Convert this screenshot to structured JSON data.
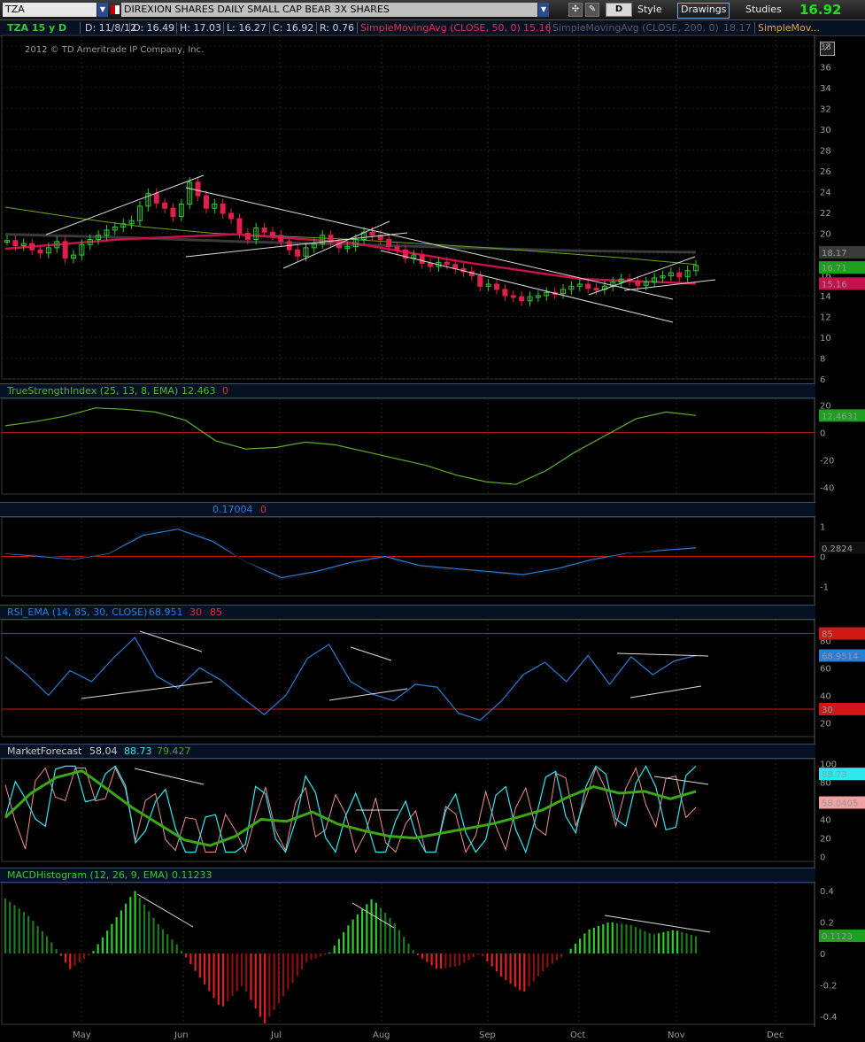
{
  "toolbar": {
    "symbol": "TZA",
    "description": "DIREXION SHARES DAILY SMALL CAP BEAR 3X SHARES",
    "d_button": "D",
    "style_label": "Style",
    "drawings_label": "Drawings",
    "studies_label": "Studies",
    "last_price": "16.92"
  },
  "quote_bar": {
    "symbol_period": "TZA 15 y D",
    "date": "D: 11/8/12",
    "open": "O: 16.49",
    "high": "H: 17.03",
    "low": "L: 16.27",
    "close": "C: 16.92",
    "range": "R: 0.76",
    "sma50_label": "SimpleMovingAvg (CLOSE, 50, 0)",
    "sma50_value": "15.16",
    "sma200_label": "SimpleMovingAvg (CLOSE, 200, 0)",
    "sma200_value": "18.17",
    "extra_label": "SimpleMov..."
  },
  "price_panel": {
    "copyright": "2012 © TD Ameritrade IP Company, Inc.",
    "ticks": [
      "38",
      "36",
      "34",
      "32",
      "30",
      "28",
      "26",
      "24",
      "22",
      "20",
      "18",
      "16",
      "14",
      "12",
      "10",
      "8",
      "6"
    ],
    "badges": [
      "18.17",
      "16.71",
      "15.16"
    ]
  },
  "tsi_panel": {
    "label": "TrueStrengthIndex (25, 13, 8, EMA)",
    "value": "12.463",
    "value2": "0",
    "ticks": [
      "20",
      "0",
      "-20",
      "-40"
    ],
    "badge": "12.4631"
  },
  "osc_panel": {
    "value": "0.17004",
    "value2": "0",
    "ticks": [
      "1",
      "0",
      "-1"
    ],
    "badge": "0.2824"
  },
  "rsi_panel": {
    "label": "RSI_EMA (14, 85, 30, CLOSE)",
    "value": "68.951",
    "ob": "30",
    "os": "85",
    "ticks": [
      "80",
      "60",
      "40",
      "20"
    ],
    "badges": [
      "85",
      "68.9514",
      "30"
    ]
  },
  "mf_panel": {
    "label": "MarketForecast",
    "v1": "58.04",
    "v2": "88.73",
    "v3": "79.427",
    "ticks": [
      "100",
      "80",
      "60",
      "40",
      "20",
      "0"
    ],
    "badges": [
      "88.73",
      "58.0405"
    ]
  },
  "macd_panel": {
    "label": "MACDHistogram (12, 26, 9, EMA)",
    "value": "0.11233",
    "ticks": [
      "0.4",
      "0.2",
      "0",
      "-0.2",
      "-0.4"
    ],
    "badge": "0.1123"
  },
  "x_axis": [
    "May",
    "Jun",
    "Jul",
    "Aug",
    "Sep",
    "Oct",
    "Nov",
    "Dec"
  ],
  "colors": {
    "up": "#2ecc2e",
    "down": "#e0204a",
    "sma200": "#3a3a3a",
    "sma50": "#c8104a",
    "sma_green": "#6aa820",
    "tsi": "#5fae28",
    "rsi": "#2a7ed8",
    "mf_cyan": "#2ee8f0",
    "mf_pink": "#f09090",
    "mf_green": "#3ca818"
  },
  "chart_data": {
    "type": "line",
    "title": "TZA 15 y D",
    "x_labels": [
      "May",
      "Jun",
      "Jul",
      "Aug",
      "Sep",
      "Oct",
      "Nov",
      "Dec"
    ],
    "price_ylim": [
      6,
      39
    ],
    "price_close_approx": [
      19.3,
      18.8,
      19.0,
      18.4,
      18.1,
      18.6,
      19.2,
      17.6,
      17.9,
      18.9,
      19.4,
      19.8,
      20.3,
      20.6,
      20.9,
      21.2,
      22.6,
      23.8,
      22.9,
      22.4,
      21.6,
      22.8,
      24.9,
      23.6,
      22.4,
      22.8,
      21.9,
      21.4,
      20.0,
      19.4,
      20.5,
      20.1,
      19.8,
      19.2,
      18.4,
      17.8,
      18.6,
      19.0,
      19.8,
      19.1,
      18.6,
      18.7,
      19.4,
      20.1,
      19.8,
      19.4,
      18.7,
      18.4,
      17.6,
      17.9,
      17.1,
      16.8,
      17.2,
      17.0,
      16.6,
      16.3,
      15.9,
      14.9,
      15.1,
      14.6,
      14.0,
      13.9,
      13.5,
      13.9,
      14.0,
      14.3,
      14.2,
      14.6,
      14.9,
      15.1,
      14.7,
      14.6,
      14.9,
      15.3,
      15.6,
      15.4,
      15.0,
      15.3,
      15.7,
      15.9,
      16.2,
      15.8,
      16.4,
      16.9
    ],
    "sma200": [
      19.9,
      19.6,
      19.2,
      18.9,
      18.6,
      18.3,
      18.17
    ],
    "sma50": [
      18.5,
      19.4,
      19.9,
      19.1,
      17.2,
      15.6,
      15.16
    ],
    "tsi_ylim": [
      -45,
      25
    ],
    "tsi_approx": [
      5,
      8,
      12,
      18,
      17,
      15,
      9,
      -6,
      -12,
      -11,
      -7,
      -9,
      -14,
      -19,
      -24,
      -31,
      -36,
      -38,
      -28,
      -14,
      -2,
      10,
      15,
      12.46
    ],
    "osc_ylim": [
      -1.3,
      1.3
    ],
    "osc_approx": [
      0.1,
      0.0,
      -0.1,
      0.1,
      0.7,
      0.9,
      0.5,
      -0.2,
      -0.7,
      -0.5,
      -0.2,
      0.0,
      -0.3,
      -0.4,
      -0.5,
      -0.6,
      -0.4,
      -0.1,
      0.1,
      0.2,
      0.28
    ],
    "rsi_ylim": [
      10,
      95
    ],
    "rsi_approx": [
      68,
      55,
      40,
      58,
      50,
      67,
      82,
      54,
      45,
      60,
      51,
      38,
      26,
      40,
      67,
      77,
      50,
      41,
      36,
      48,
      46,
      27,
      22,
      36,
      55,
      64,
      50,
      69,
      48,
      68,
      55,
      65,
      68.95
    ],
    "mf_ylim": [
      -5,
      105
    ],
    "mf_green_approx": [
      42,
      68,
      85,
      92,
      72,
      52,
      35,
      18,
      12,
      22,
      40,
      38,
      48,
      35,
      28,
      22,
      20,
      25,
      30,
      35,
      42,
      50,
      64,
      75,
      68,
      70,
      62,
      70
    ],
    "macd_ylim": [
      -0.45,
      0.45
    ],
    "macd_hist_approx": [
      0.35,
      0.25,
      0.1,
      -0.1,
      0.0,
      0.2,
      0.4,
      0.2,
      0.05,
      -0.15,
      -0.35,
      -0.2,
      -0.45,
      -0.25,
      -0.05,
      0.0,
      0.2,
      0.35,
      0.2,
      0.0,
      -0.1,
      -0.08,
      0.0,
      -0.15,
      -0.25,
      -0.1,
      0.0,
      0.15,
      0.2,
      0.18,
      0.12,
      0.15,
      0.11
    ]
  }
}
